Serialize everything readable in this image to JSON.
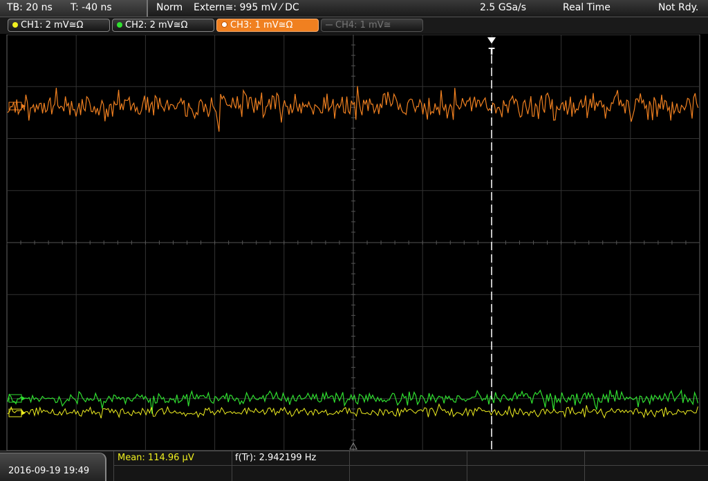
{
  "top": {
    "timebase": "TB: 20 ns",
    "trigger_time": "T: -40 ns",
    "mode": "Norm",
    "trigger_source": "Extern≅: 995 mV ⁄ DC",
    "sample_rate": "2.5 GSa/s",
    "acq_mode": "Real Time",
    "status": "Not Rdy."
  },
  "channels": [
    {
      "label": "CH1: 2 mV≅Ω",
      "color": "#f0f020",
      "active": true
    },
    {
      "label": "CH2: 2 mV≅Ω",
      "color": "#30e030",
      "active": true
    },
    {
      "label": "CH3: 1 mV≅Ω",
      "color": "#f08020",
      "active": true,
      "selected": true
    },
    {
      "label": "CH4: 1 mV≅",
      "color": "#777777",
      "active": false
    }
  ],
  "trigger_marker": "T",
  "measurements": {
    "mean": "Mean: 114.96 µV",
    "freq": "f(Tr): 2.942199 Hz"
  },
  "datetime": "2016-09-19 19:49",
  "colors": {
    "ch1": "#f0f020",
    "ch2": "#30e030",
    "ch3": "#f08020",
    "grid": "#3c3c3c",
    "grid_center": "#555555"
  }
}
